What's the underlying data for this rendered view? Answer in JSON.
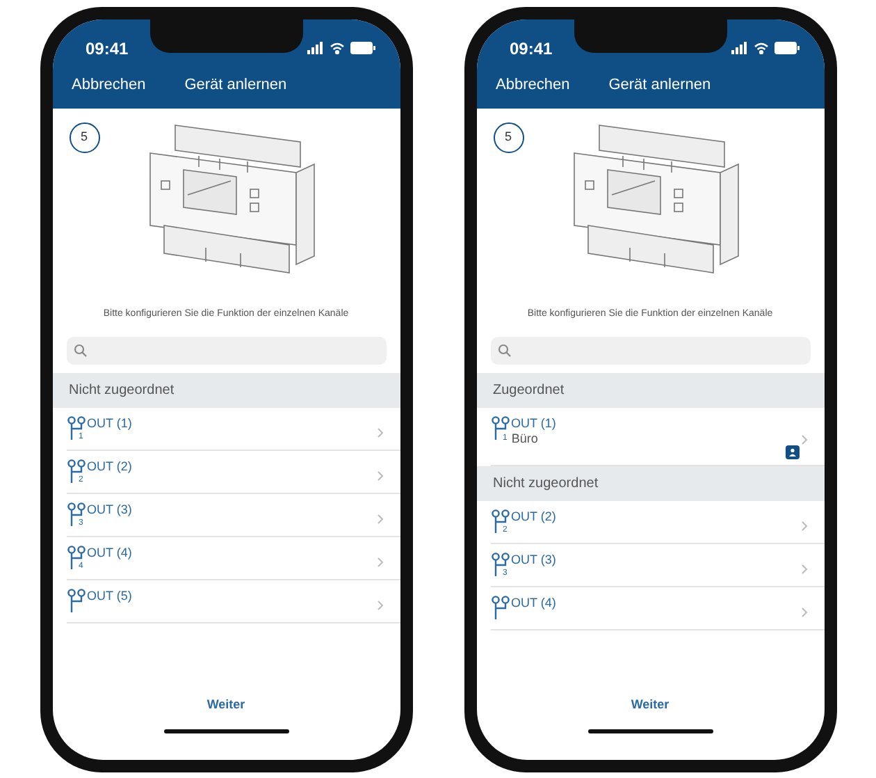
{
  "phones": [
    {
      "status_bar": {
        "time": "09:41"
      },
      "nav": {
        "cancel": "Abbrechen",
        "title": "Gerät anlernen"
      },
      "step": "5",
      "instruction": "Bitte konfigurieren Sie die Funktion der einzelnen Kanäle",
      "sections": [
        {
          "title": "Nicht zugeordnet",
          "items": [
            {
              "label": "OUT (1)",
              "index": "1",
              "badge": false
            },
            {
              "label": "OUT (2)",
              "index": "2",
              "badge": false
            },
            {
              "label": "OUT (3)",
              "index": "3",
              "badge": false
            },
            {
              "label": "OUT (4)",
              "index": "4",
              "badge": false
            },
            {
              "label": "OUT (5)",
              "badge": false
            }
          ]
        }
      ],
      "footer_button": "Weiter"
    },
    {
      "status_bar": {
        "time": "09:41"
      },
      "nav": {
        "cancel": "Abbrechen",
        "title": "Gerät anlernen"
      },
      "step": "5",
      "instruction": "Bitte konfigurieren Sie die Funktion der einzelnen Kanäle",
      "sections": [
        {
          "title": "Zugeordnet",
          "items": [
            {
              "label": "OUT (1)",
              "index": "1",
              "room": "Büro",
              "badge": true
            }
          ]
        },
        {
          "title": "Nicht zugeordnet",
          "items": [
            {
              "label": "OUT (2)",
              "index": "2",
              "badge": false
            },
            {
              "label": "OUT (3)",
              "index": "3",
              "badge": false
            },
            {
              "label": "OUT (4)",
              "badge": false
            }
          ]
        }
      ],
      "footer_button": "Weiter"
    }
  ]
}
